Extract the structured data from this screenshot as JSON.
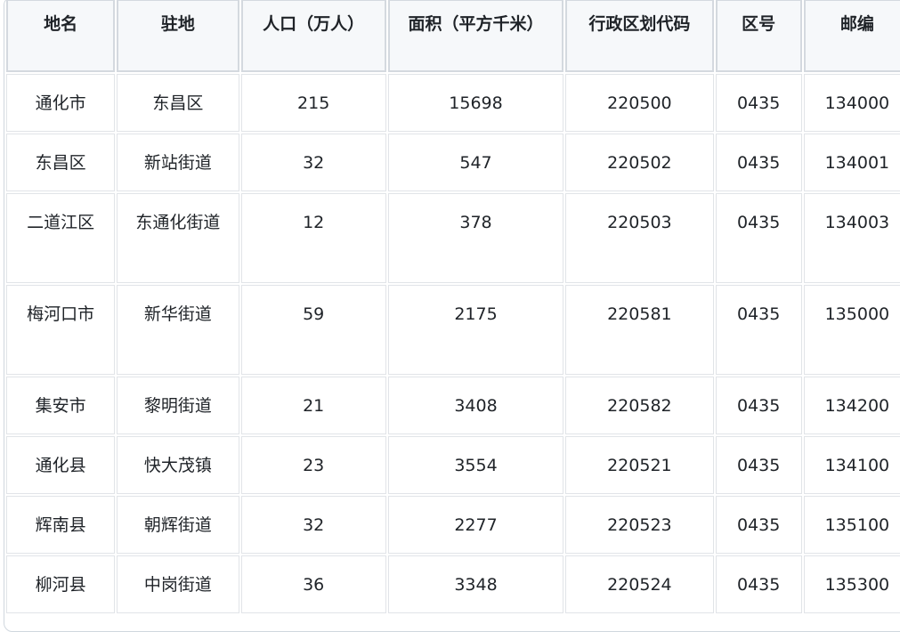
{
  "table": {
    "headers": [
      "地名",
      "驻地",
      "人口（万人）",
      "面积（平方千米）",
      "行政区划代码",
      "区号",
      "邮编"
    ],
    "rows": [
      [
        "通化市",
        "东昌区",
        "215",
        "15698",
        "220500",
        "0435",
        "134000"
      ],
      [
        "东昌区",
        "新站街道",
        "32",
        "547",
        "220502",
        "0435",
        "134001"
      ],
      [
        "二道江区",
        "东通化街道",
        "12",
        "378",
        "220503",
        "0435",
        "134003"
      ],
      [
        "梅河口市",
        "新华街道",
        "59",
        "2175",
        "220581",
        "0435",
        "135000"
      ],
      [
        "集安市",
        "黎明街道",
        "21",
        "3408",
        "220582",
        "0435",
        "134200"
      ],
      [
        "通化县",
        "快大茂镇",
        "23",
        "3554",
        "220521",
        "0435",
        "134100"
      ],
      [
        "辉南县",
        "朝辉街道",
        "32",
        "2277",
        "220523",
        "0435",
        "135100"
      ],
      [
        "柳河县",
        "中岗街道",
        "36",
        "3348",
        "220524",
        "0435",
        "135300"
      ]
    ]
  }
}
